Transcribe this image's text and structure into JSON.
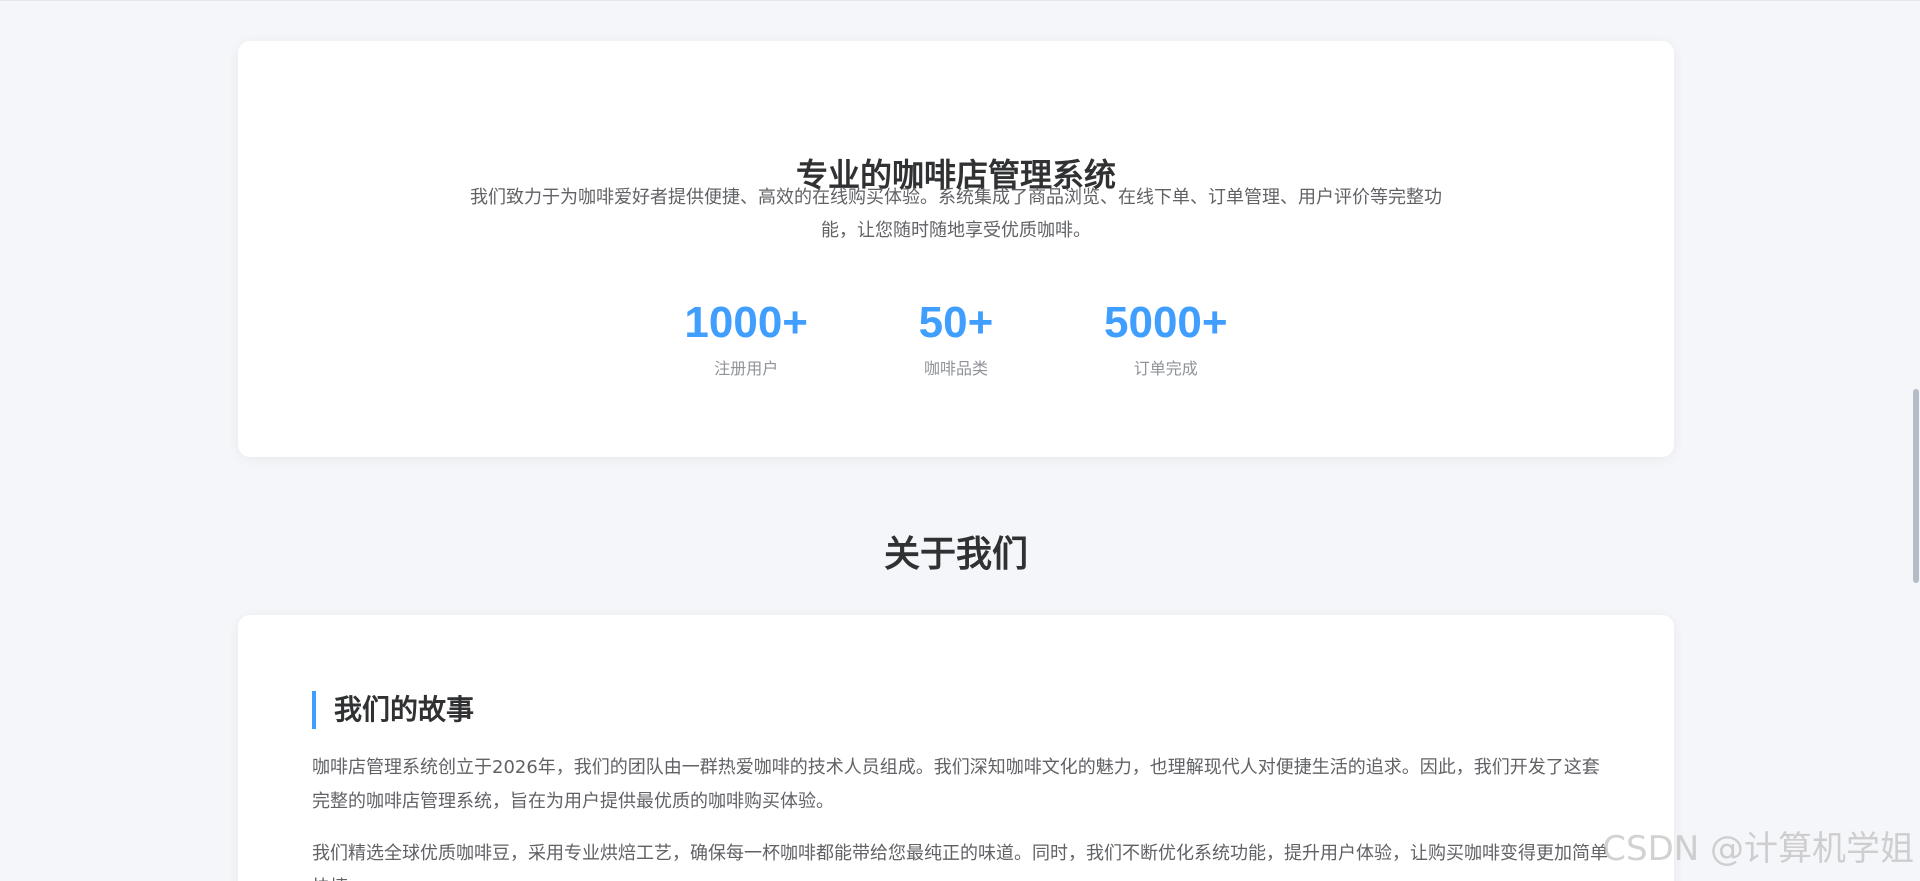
{
  "intro": {
    "title": "专业的咖啡店管理系统",
    "description": "我们致力于为咖啡爱好者提供便捷、高效的在线购买体验。系统集成了商品浏览、在线下单、订单管理、用户评价等完整功能，让您随时随地享受优质咖啡。",
    "stats": [
      {
        "value": "1000+",
        "label": "注册用户"
      },
      {
        "value": "50+",
        "label": "咖啡品类"
      },
      {
        "value": "5000+",
        "label": "订单完成"
      }
    ]
  },
  "about": {
    "section_title": "关于我们",
    "story_title": "我们的故事",
    "paragraphs": [
      "咖啡店管理系统创立于2026年，我们的团队由一群热爱咖啡的技术人员组成。我们深知咖啡文化的魅力，也理解现代人对便捷生活的追求。因此，我们开发了这套完整的咖啡店管理系统，旨在为用户提供最优质的咖啡购买体验。",
      "我们精选全球优质咖啡豆，采用专业烘焙工艺，确保每一杯咖啡都能带给您最纯正的味道。同时，我们不断优化系统功能，提升用户体验，让购买咖啡变得更加简单快捷。"
    ]
  },
  "watermark": "CSDN @计算机学姐",
  "colors": {
    "accent": "#409eff",
    "page_bg": "#f5f6f9",
    "card_bg": "#ffffff"
  }
}
